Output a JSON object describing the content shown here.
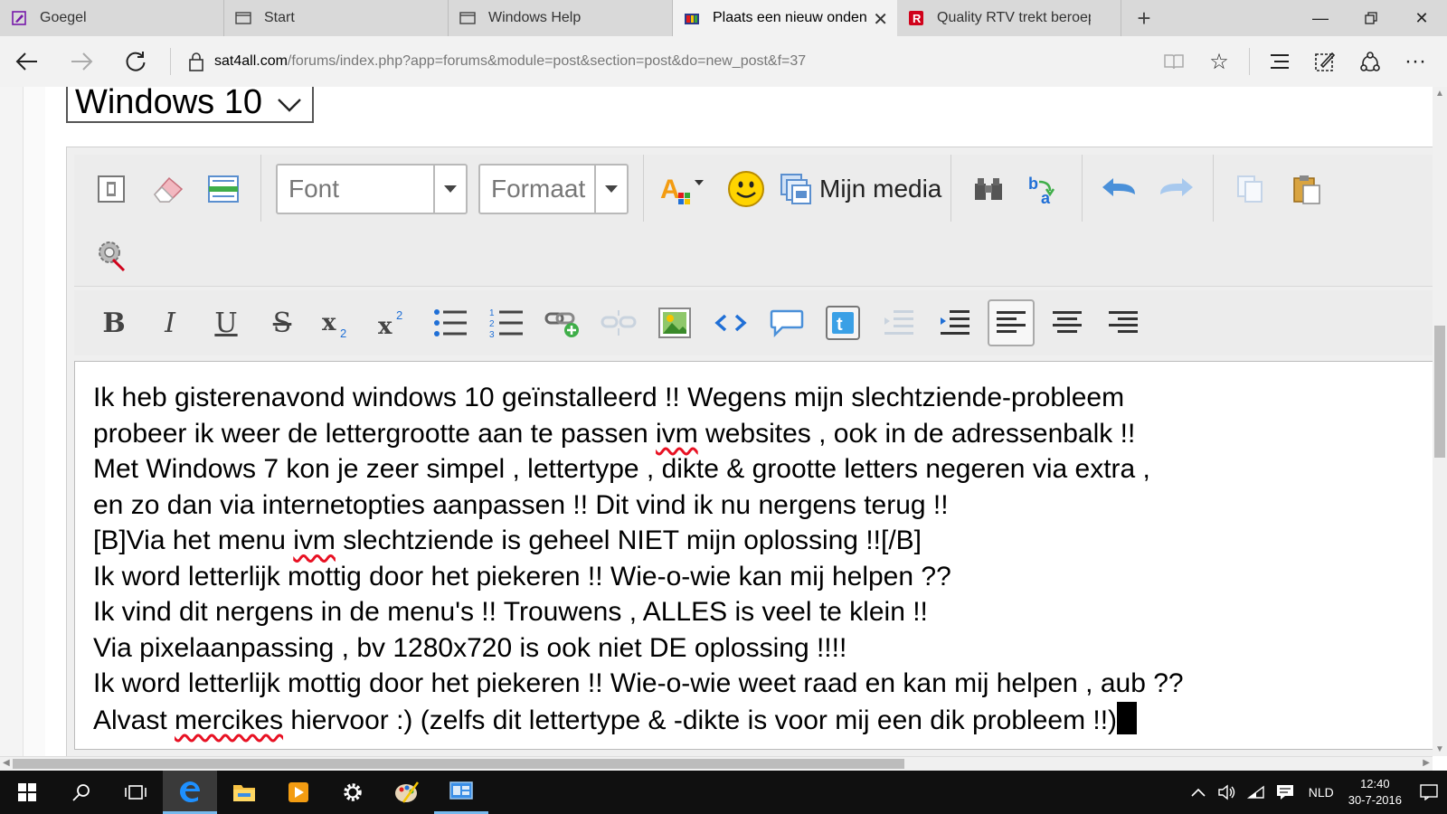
{
  "tabs": [
    {
      "label": "Goegel",
      "icon": "onenote-icon"
    },
    {
      "label": "Start",
      "icon": "page-icon"
    },
    {
      "label": "Windows Help",
      "icon": "page-icon"
    },
    {
      "label": "Plaats een nieuw onden",
      "icon": "sat4all-icon",
      "active": true
    },
    {
      "label": "Quality RTV trekt beroep teç",
      "icon": "r-logo-icon"
    }
  ],
  "address": {
    "domain": "sat4all.com",
    "path": "/forums/index.php?app=forums&module=post&section=post&do=new_post&f=37"
  },
  "select": {
    "value": "Windows 10"
  },
  "toolbar": {
    "font_placeholder": "Font",
    "format_placeholder": "Formaat",
    "media_label": "Mijn media"
  },
  "post_lines": [
    "Ik heb gisterenavond windows 10 geïnstalleerd !! Wegens mijn slechtziende-probleem",
    "probeer ik weer de lettergrootte aan te passen ivm websites , ook in de adressenbalk !!",
    "Met Windows 7 kon je zeer simpel , lettertype , dikte & grootte letters negeren via extra ,",
    "en zo dan via internetopties aanpassen !! Dit vind ik nu nergens terug !!",
    "[B]Via het menu ivm slechtziende is geheel NIET mijn oplossing !![/B]",
    "Ik word letterlijk mottig door het piekeren !! Wie-o-wie kan mij helpen ??",
    "Ik vind dit nergens in de menu's !! Trouwens , ALLES is veel te klein !!",
    "Via pixelaanpassing , bv 1280x720 is ook niet DE oplossing !!!!",
    "Ik word letterlijk mottig door het piekeren !! Wie-o-wie weet raad en kan mij helpen , aub ??",
    "Alvast mercikes hiervoor :) (zelfs dit lettertype & -dikte is voor mij een dik probleem !!)"
  ],
  "taskbar": {
    "language": "NLD",
    "time": "12:40",
    "date": "30-7-2016"
  },
  "colors": {
    "edge_blue": "#0078d7",
    "spell_red": "#e81123",
    "taskbar_bg": "#101010"
  }
}
